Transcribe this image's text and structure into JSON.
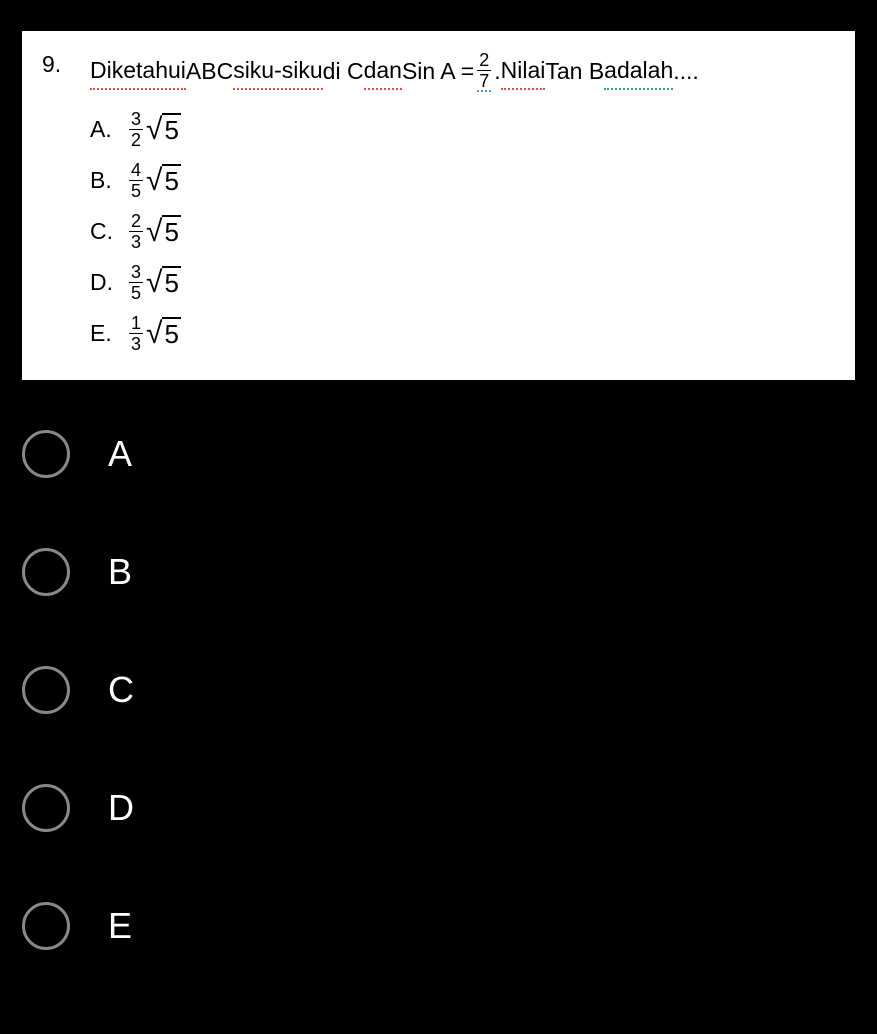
{
  "question": {
    "number": "9.",
    "text_parts": {
      "p1": "Diketahui",
      "p2": " ABC ",
      "p3": "siku-siku",
      "p4": " di C ",
      "p5": "dan",
      "p6": " Sin A = ",
      "frac_num": "2",
      "frac_den": "7",
      "p7": ". ",
      "p8": "Nilai",
      "p9": " Tan B ",
      "p10": "adalah",
      "p11": " ...."
    },
    "image_options": [
      {
        "letter": "A.",
        "frac_num": "3",
        "frac_den": "2",
        "sqrt_val": "5"
      },
      {
        "letter": "B.",
        "frac_num": "4",
        "frac_den": "5",
        "sqrt_val": "5"
      },
      {
        "letter": "C.",
        "frac_num": "2",
        "frac_den": "3",
        "sqrt_val": "5"
      },
      {
        "letter": "D.",
        "frac_num": "3",
        "frac_den": "5",
        "sqrt_val": "5"
      },
      {
        "letter": "E.",
        "frac_num": "1",
        "frac_den": "3",
        "sqrt_val": "5"
      }
    ]
  },
  "answer_choices": [
    {
      "label": "A"
    },
    {
      "label": "B"
    },
    {
      "label": "C"
    },
    {
      "label": "D"
    },
    {
      "label": "E"
    }
  ]
}
